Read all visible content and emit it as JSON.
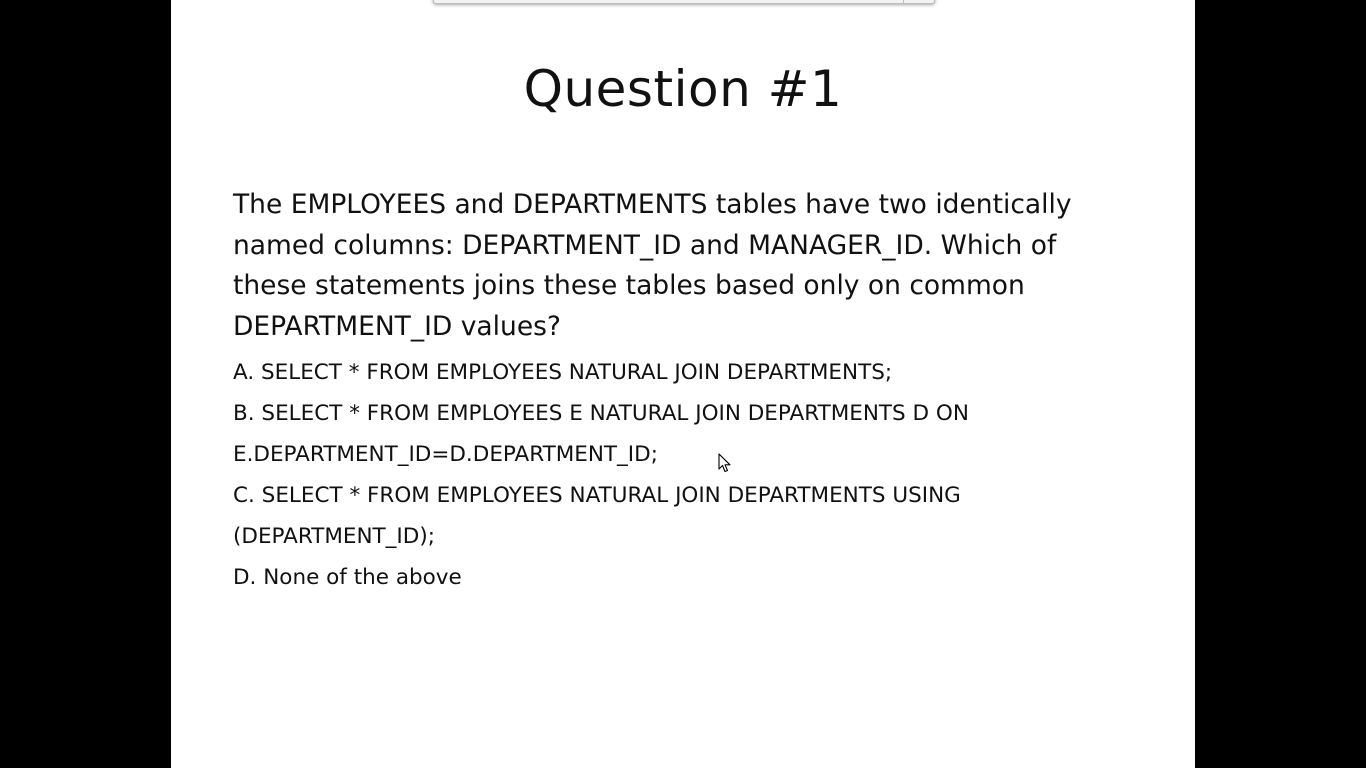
{
  "slide": {
    "title": "Question #1",
    "question_lines": [
      "The EMPLOYEES and DEPARTMENTS tables have two identically",
      "named columns: DEPARTMENT_ID and MANAGER_ID. Which of",
      "these statements joins these tables based only on common",
      "DEPARTMENT_ID values?"
    ],
    "option_lines": [
      "A. SELECT * FROM EMPLOYEES NATURAL JOIN DEPARTMENTS;",
      "B. SELECT * FROM EMPLOYEES E NATURAL JOIN DEPARTMENTS D ON",
      "E.DEPARTMENT_ID=D.DEPARTMENT_ID;",
      "C. SELECT * FROM EMPLOYEES NATURAL JOIN DEPARTMENTS USING",
      "(DEPARTMENT_ID);",
      "D. None of the above"
    ]
  },
  "colors": {
    "background": "#000000",
    "slide": "#ffffff",
    "text": "#111111"
  },
  "icons": {
    "cursor": "mouse-pointer-icon"
  }
}
